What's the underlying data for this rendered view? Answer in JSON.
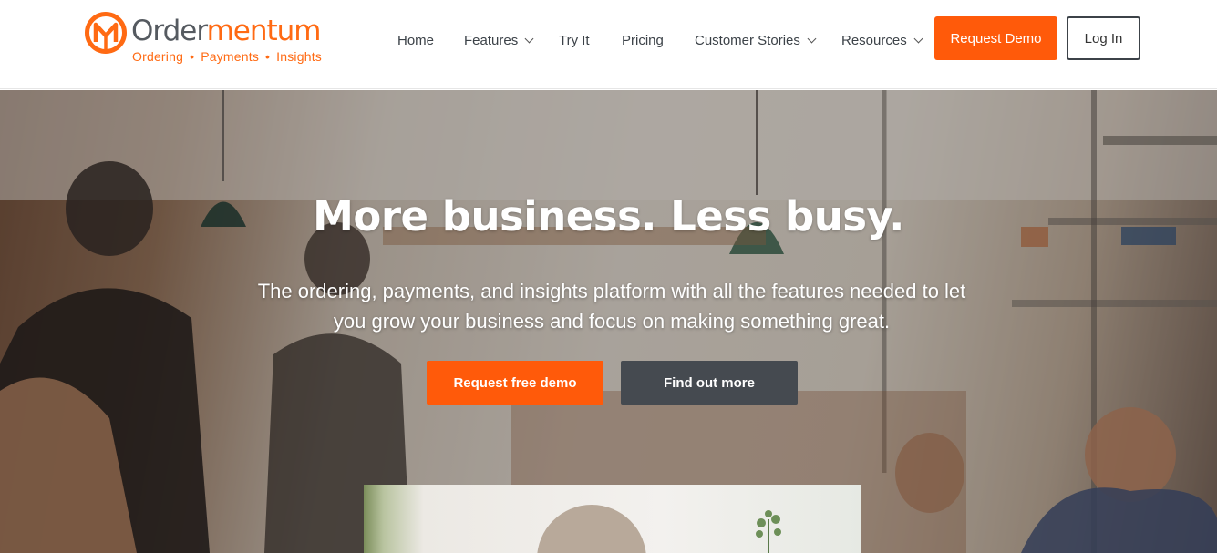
{
  "brand": {
    "logo_letter": "M",
    "name_part1": "Order",
    "name_part2": "mentum",
    "tagline": [
      "Ordering",
      "Payments",
      "Insights"
    ],
    "accent_color": "#ff5a0a",
    "dark_color": "#3c4248"
  },
  "nav": {
    "items": [
      {
        "label": "Home",
        "has_dropdown": false
      },
      {
        "label": "Features",
        "has_dropdown": true
      },
      {
        "label": "Try It",
        "has_dropdown": false
      },
      {
        "label": "Pricing",
        "has_dropdown": false
      },
      {
        "label": "Customer Stories",
        "has_dropdown": true
      },
      {
        "label": "Resources",
        "has_dropdown": true
      }
    ],
    "request_demo_label": "Request Demo",
    "login_label": "Log In"
  },
  "hero": {
    "headline": "More business. Less busy.",
    "subheadline": "The ordering, payments, and insights platform with all the features needed to let you grow your business and focus on making something great.",
    "primary_cta": "Request free demo",
    "secondary_cta": "Find out more"
  }
}
